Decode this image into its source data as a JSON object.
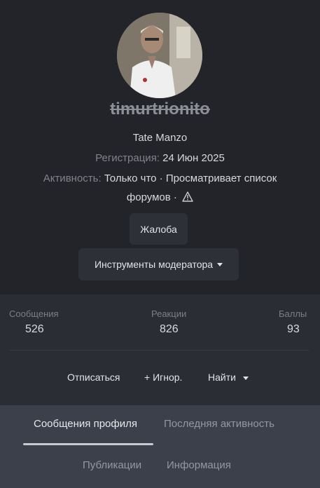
{
  "profile": {
    "username": "timurtrionito",
    "display_name": "Tate Manzo",
    "registered_label": "Регистрация:",
    "registered_value": "24 Июн 2025",
    "activity_label": "Активность:",
    "activity_value_line1": "Только что · Просматривает список",
    "activity_value_line2": "форумов ·",
    "warning_icon": "warning-triangle-icon"
  },
  "buttons": {
    "report": "Жалоба",
    "moderator_tools": "Инструменты модератора"
  },
  "stats": {
    "messages_label": "Сообщения",
    "messages_value": "526",
    "reactions_label": "Реакции",
    "reactions_value": "826",
    "points_label": "Баллы",
    "points_value": "93"
  },
  "actions": {
    "unsubscribe": "Отписаться",
    "ignore": "+ Игнор.",
    "find": "Найти"
  },
  "tabs": {
    "profile_posts": "Сообщения профиля",
    "latest_activity": "Последняя активность",
    "publications": "Публикации",
    "info": "Информация"
  },
  "colors": {
    "background": "#222429",
    "stats_background": "#2a2d33",
    "tabs_background": "#3b404b"
  }
}
